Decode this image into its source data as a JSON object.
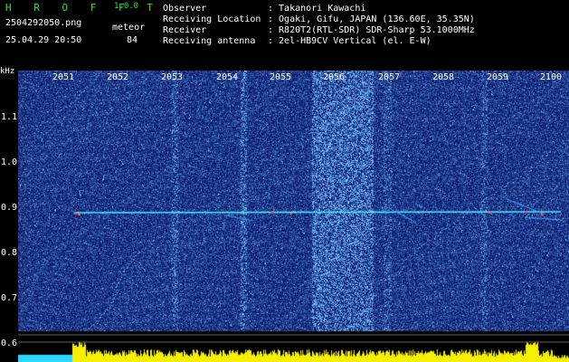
{
  "header": {
    "app_title": "H R O F F T",
    "app_version": "1.0.0",
    "file_name": "2504292050.png",
    "datetime": "25.04.29 20:50",
    "meteor_label": "meteor",
    "meteor_count": "84"
  },
  "info": [
    {
      "label": "Observer",
      "value": ": Takanori Kawachi"
    },
    {
      "label": "Receiving Location",
      "value": ": Ogaki, Gifu, JAPAN (136.60E, 35.35N)"
    },
    {
      "label": "Receiver",
      "value": ": R820T2(RTL-SDR) SDR-Sharp 53.1000MHz"
    },
    {
      "label": "Receiving antenna",
      "value": ": 2el-HB9CV Vertical (el. E-W)"
    }
  ],
  "axes": {
    "y_unit": "kHz",
    "x_ticks": [
      "2051",
      "2052",
      "2053",
      "2054",
      "2055",
      "2056",
      "2057",
      "2058",
      "2059",
      "2100"
    ],
    "y_ticks": [
      "1.1",
      "1.0",
      "0.9",
      "0.8",
      "0.7",
      "0.6"
    ]
  },
  "colors": {
    "background": "#000000",
    "title_green": "#2ee03a",
    "spectrogram_noise": "#10208a",
    "echo_line": "#46f0ff",
    "activity_bars": "#f5f000",
    "level_cyan": "#29d6ff"
  }
}
